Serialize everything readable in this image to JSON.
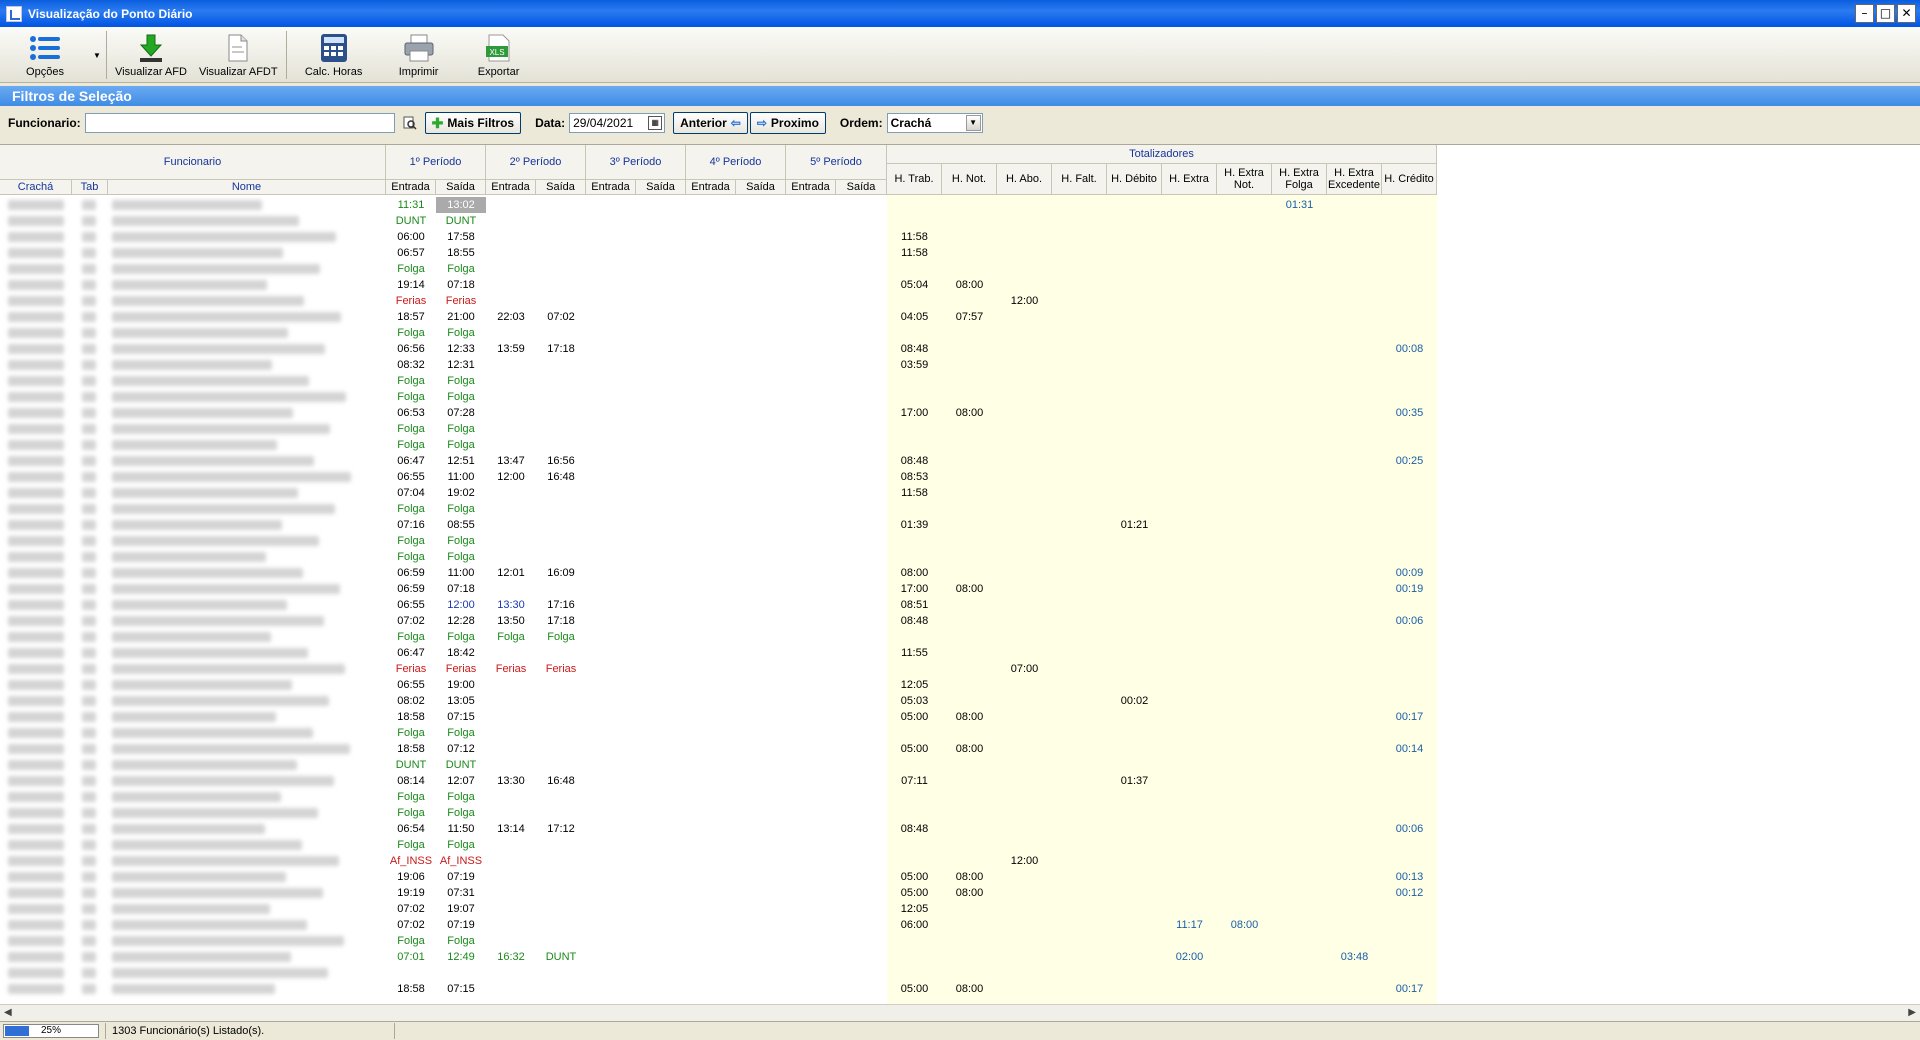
{
  "window": {
    "title": "Visualização do Ponto Diário",
    "btn_min": "–",
    "btn_max": "□",
    "btn_close": "✕"
  },
  "toolbar": [
    {
      "label": "Opções",
      "icon": "list-icon"
    },
    {
      "label": "Visualizar AFD",
      "icon": "download-icon"
    },
    {
      "label": "Visualizar AFDT",
      "icon": "document-icon"
    },
    {
      "label": "Calc. Horas",
      "icon": "calculator-icon"
    },
    {
      "label": "Imprimir",
      "icon": "printer-icon"
    },
    {
      "label": "Exportar",
      "icon": "xls-icon"
    }
  ],
  "filters": {
    "section_title": "Filtros de Seleção",
    "funcionario_label": "Funcionario:",
    "funcionario_value": "",
    "mais_filtros": "Mais Filtros",
    "data_label": "Data:",
    "data_value": "29/04/2021",
    "anterior": "Anterior",
    "proximo": "Proximo",
    "ordem_label": "Ordem:",
    "ordem_value": "Crachá"
  },
  "grid": {
    "group_funcionario": "Funcionario",
    "periods": [
      "1º Período",
      "2º Período",
      "3º Período",
      "4º Período",
      "5º Período"
    ],
    "totalizadores": "Totalizadores",
    "col_cracha": "Crachá",
    "col_tab": "Tab",
    "col_nome": "Nome",
    "entrada": "Entrada",
    "saida": "Saída",
    "totals": [
      "H. Trab.",
      "H. Not.",
      "H. Abo.",
      "H. Falt.",
      "H. Débito",
      "H. Extra",
      "H. Extra Not.",
      "H. Extra Folga",
      "H. Extra Excedente",
      "H. Crédito"
    ]
  },
  "rows": [
    {
      "p": [
        [
          "11:31",
          "g"
        ],
        [
          "13:02",
          "hl"
        ]
      ],
      "t": {
        "7": "01:31"
      }
    },
    {
      "p": [
        [
          "DUNT",
          "g"
        ],
        [
          "DUNT",
          "g"
        ]
      ],
      "t": {}
    },
    {
      "p": [
        [
          "06:00",
          "k"
        ],
        [
          "17:58",
          "k"
        ]
      ],
      "t": {
        "0": "11:58"
      }
    },
    {
      "p": [
        [
          "06:57",
          "k"
        ],
        [
          "18:55",
          "k"
        ]
      ],
      "t": {
        "0": "11:58"
      }
    },
    {
      "p": [
        [
          "Folga",
          "g"
        ],
        [
          "Folga",
          "g"
        ]
      ],
      "t": {}
    },
    {
      "p": [
        [
          "19:14",
          "k"
        ],
        [
          "07:18",
          "k"
        ]
      ],
      "t": {
        "0": "05:04",
        "1": "08:00"
      }
    },
    {
      "p": [
        [
          "Ferias",
          "r"
        ],
        [
          "Ferias",
          "r"
        ]
      ],
      "t": {
        "2": "12:00"
      }
    },
    {
      "p": [
        [
          "18:57",
          "k"
        ],
        [
          "21:00",
          "k"
        ],
        [
          "22:03",
          "k"
        ],
        [
          "07:02",
          "k"
        ]
      ],
      "t": {
        "0": "04:05",
        "1": "07:57"
      }
    },
    {
      "p": [
        [
          "Folga",
          "g"
        ],
        [
          "Folga",
          "g"
        ]
      ],
      "t": {}
    },
    {
      "p": [
        [
          "06:56",
          "k"
        ],
        [
          "12:33",
          "k"
        ],
        [
          "13:59",
          "k"
        ],
        [
          "17:18",
          "k"
        ]
      ],
      "t": {
        "0": "08:48",
        "9": "00:08"
      }
    },
    {
      "p": [
        [
          "08:32",
          "k"
        ],
        [
          "12:31",
          "k"
        ]
      ],
      "t": {
        "0": "03:59"
      }
    },
    {
      "p": [
        [
          "Folga",
          "g"
        ],
        [
          "Folga",
          "g"
        ]
      ],
      "t": {}
    },
    {
      "p": [
        [
          "Folga",
          "g"
        ],
        [
          "Folga",
          "g"
        ]
      ],
      "t": {}
    },
    {
      "p": [
        [
          "06:53",
          "k"
        ],
        [
          "07:28",
          "k"
        ]
      ],
      "t": {
        "0": "17:00",
        "1": "08:00",
        "9": "00:35"
      }
    },
    {
      "p": [
        [
          "Folga",
          "g"
        ],
        [
          "Folga",
          "g"
        ]
      ],
      "t": {}
    },
    {
      "p": [
        [
          "Folga",
          "g"
        ],
        [
          "Folga",
          "g"
        ]
      ],
      "t": {}
    },
    {
      "p": [
        [
          "06:47",
          "k"
        ],
        [
          "12:51",
          "k"
        ],
        [
          "13:47",
          "k"
        ],
        [
          "16:56",
          "k"
        ]
      ],
      "t": {
        "0": "08:48",
        "9": "00:25"
      }
    },
    {
      "p": [
        [
          "06:55",
          "k"
        ],
        [
          "11:00",
          "k"
        ],
        [
          "12:00",
          "k"
        ],
        [
          "16:48",
          "k"
        ]
      ],
      "t": {
        "0": "08:53"
      }
    },
    {
      "p": [
        [
          "07:04",
          "k"
        ],
        [
          "19:02",
          "k"
        ]
      ],
      "t": {
        "0": "11:58"
      }
    },
    {
      "p": [
        [
          "Folga",
          "g"
        ],
        [
          "Folga",
          "g"
        ]
      ],
      "t": {}
    },
    {
      "p": [
        [
          "07:16",
          "k"
        ],
        [
          "08:55",
          "k"
        ]
      ],
      "t": {
        "0": "01:39",
        "4": "01:21"
      }
    },
    {
      "p": [
        [
          "Folga",
          "g"
        ],
        [
          "Folga",
          "g"
        ]
      ],
      "t": {}
    },
    {
      "p": [
        [
          "Folga",
          "g"
        ],
        [
          "Folga",
          "g"
        ]
      ],
      "t": {}
    },
    {
      "p": [
        [
          "06:59",
          "k"
        ],
        [
          "11:00",
          "k"
        ],
        [
          "12:01",
          "k"
        ],
        [
          "16:09",
          "k"
        ]
      ],
      "t": {
        "0": "08:00",
        "9": "00:09"
      }
    },
    {
      "p": [
        [
          "06:59",
          "k"
        ],
        [
          "07:18",
          "k"
        ]
      ],
      "t": {
        "0": "17:00",
        "1": "08:00",
        "9": "00:19"
      }
    },
    {
      "p": [
        [
          "06:55",
          "k"
        ],
        [
          "12:00",
          "b"
        ],
        [
          "13:30",
          "b"
        ],
        [
          "17:16",
          "k"
        ]
      ],
      "t": {
        "0": "08:51"
      }
    },
    {
      "p": [
        [
          "07:02",
          "k"
        ],
        [
          "12:28",
          "k"
        ],
        [
          "13:50",
          "k"
        ],
        [
          "17:18",
          "k"
        ]
      ],
      "t": {
        "0": "08:48",
        "9": "00:06"
      }
    },
    {
      "p": [
        [
          "Folga",
          "g"
        ],
        [
          "Folga",
          "g"
        ],
        [
          "Folga",
          "g"
        ],
        [
          "Folga",
          "g"
        ]
      ],
      "t": {}
    },
    {
      "p": [
        [
          "06:47",
          "k"
        ],
        [
          "18:42",
          "k"
        ]
      ],
      "t": {
        "0": "11:55"
      }
    },
    {
      "p": [
        [
          "Ferias",
          "r"
        ],
        [
          "Ferias",
          "r"
        ],
        [
          "Ferias",
          "r"
        ],
        [
          "Ferias",
          "r"
        ]
      ],
      "t": {
        "2": "07:00"
      }
    },
    {
      "p": [
        [
          "06:55",
          "k"
        ],
        [
          "19:00",
          "k"
        ]
      ],
      "t": {
        "0": "12:05"
      }
    },
    {
      "p": [
        [
          "08:02",
          "k"
        ],
        [
          "13:05",
          "k"
        ]
      ],
      "t": {
        "0": "05:03",
        "4": "00:02"
      }
    },
    {
      "p": [
        [
          "18:58",
          "k"
        ],
        [
          "07:15",
          "k"
        ]
      ],
      "t": {
        "0": "05:00",
        "1": "08:00",
        "9": "00:17"
      }
    },
    {
      "p": [
        [
          "Folga",
          "g"
        ],
        [
          "Folga",
          "g"
        ]
      ],
      "t": {}
    },
    {
      "p": [
        [
          "18:58",
          "k"
        ],
        [
          "07:12",
          "k"
        ]
      ],
      "t": {
        "0": "05:00",
        "1": "08:00",
        "9": "00:14"
      }
    },
    {
      "p": [
        [
          "DUNT",
          "g"
        ],
        [
          "DUNT",
          "g"
        ]
      ],
      "t": {}
    },
    {
      "p": [
        [
          "08:14",
          "k"
        ],
        [
          "12:07",
          "k"
        ],
        [
          "13:30",
          "k"
        ],
        [
          "16:48",
          "k"
        ]
      ],
      "t": {
        "0": "07:11",
        "4": "01:37"
      }
    },
    {
      "p": [
        [
          "Folga",
          "g"
        ],
        [
          "Folga",
          "g"
        ]
      ],
      "t": {}
    },
    {
      "p": [
        [
          "Folga",
          "g"
        ],
        [
          "Folga",
          "g"
        ]
      ],
      "t": {}
    },
    {
      "p": [
        [
          "06:54",
          "k"
        ],
        [
          "11:50",
          "k"
        ],
        [
          "13:14",
          "k"
        ],
        [
          "17:12",
          "k"
        ]
      ],
      "t": {
        "0": "08:48",
        "9": "00:06"
      }
    },
    {
      "p": [
        [
          "Folga",
          "g"
        ],
        [
          "Folga",
          "g"
        ]
      ],
      "t": {}
    },
    {
      "p": [
        [
          "Af_INSS",
          "r"
        ],
        [
          "Af_INSS",
          "r"
        ]
      ],
      "t": {
        "2": "12:00"
      }
    },
    {
      "p": [
        [
          "19:06",
          "k"
        ],
        [
          "07:19",
          "k"
        ]
      ],
      "t": {
        "0": "05:00",
        "1": "08:00",
        "9": "00:13"
      }
    },
    {
      "p": [
        [
          "19:19",
          "k"
        ],
        [
          "07:31",
          "k"
        ]
      ],
      "t": {
        "0": "05:00",
        "1": "08:00",
        "9": "00:12"
      }
    },
    {
      "p": [
        [
          "07:02",
          "k"
        ],
        [
          "19:07",
          "k"
        ]
      ],
      "t": {
        "0": "12:05"
      }
    },
    {
      "p": [
        [
          "07:02",
          "k"
        ],
        [
          "07:19",
          "k"
        ]
      ],
      "t": {
        "0": "06:00",
        "5": "11:17",
        "6": "08:00"
      }
    },
    {
      "p": [
        [
          "Folga",
          "g"
        ],
        [
          "Folga",
          "g"
        ]
      ],
      "t": {}
    },
    {
      "p": [
        [
          "07:01",
          "g"
        ],
        [
          "12:49",
          "g"
        ],
        [
          "16:32",
          "g"
        ],
        [
          "DUNT",
          "g"
        ]
      ],
      "t": {
        "5": "02:00",
        "8": "03:48"
      }
    },
    {
      "p": [],
      "t": {}
    },
    {
      "p": [
        [
          "18:58",
          "k"
        ],
        [
          "07:15",
          "k"
        ]
      ],
      "t": {
        "0": "05:00",
        "1": "08:00",
        "9": "00:17"
      }
    }
  ],
  "status": {
    "progress_value": 0.25,
    "progress_label": "25%",
    "message": "1303 Funcionário(s) Listado(s)."
  }
}
